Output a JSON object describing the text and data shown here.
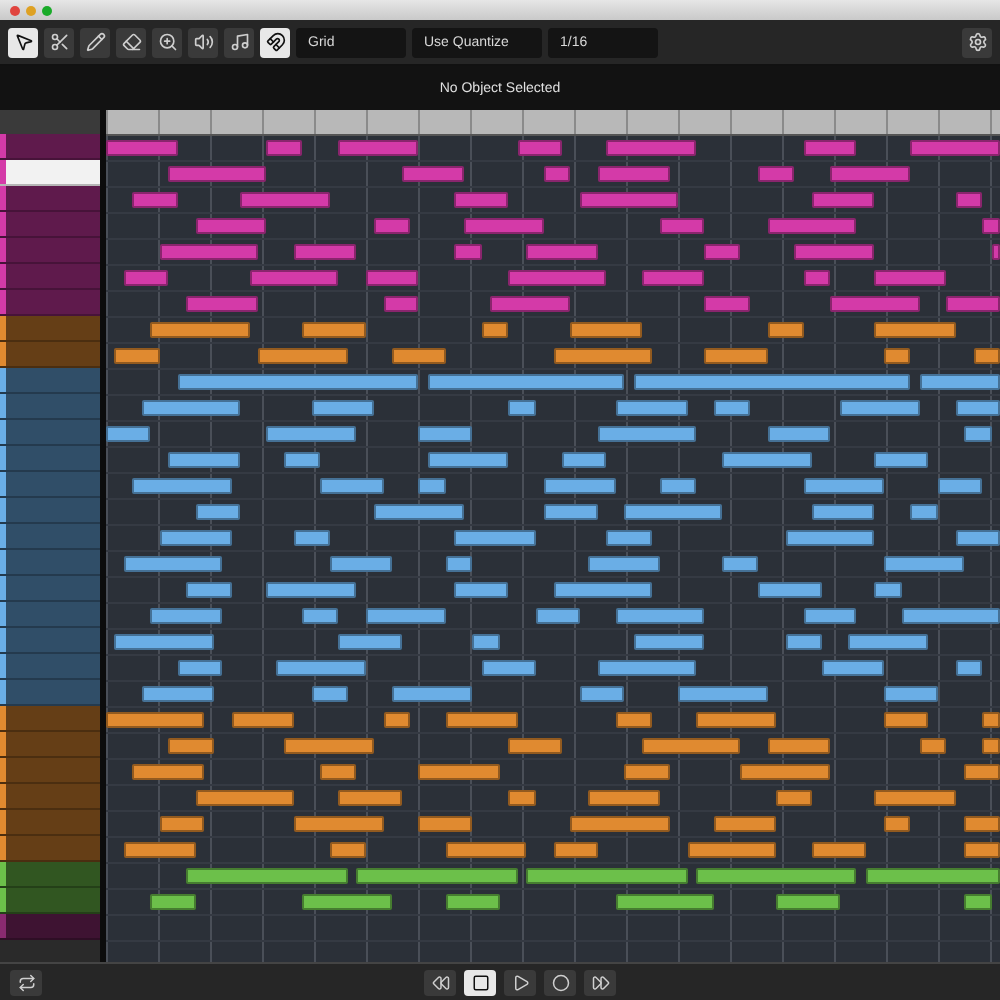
{
  "toolbar": {
    "snap_mode": "Grid",
    "quantize_mode": "Use Quantize",
    "quantize_value": "1/16"
  },
  "info_line": "No Object Selected",
  "tracks": [
    {
      "color": "#d43aa8",
      "selected": false
    },
    {
      "color": "#d43aa8",
      "selected": true
    },
    {
      "color": "#d43aa8",
      "selected": false
    },
    {
      "color": "#d43aa8",
      "selected": false
    },
    {
      "color": "#d43aa8",
      "selected": false
    },
    {
      "color": "#d43aa8",
      "selected": false
    },
    {
      "color": "#d43aa8",
      "selected": false
    },
    {
      "color": "#e08a30",
      "selected": false
    },
    {
      "color": "#e08a30",
      "selected": false
    },
    {
      "color": "#6aaee6",
      "selected": false
    },
    {
      "color": "#6aaee6",
      "selected": false
    },
    {
      "color": "#6aaee6",
      "selected": false
    },
    {
      "color": "#6aaee6",
      "selected": false
    },
    {
      "color": "#6aaee6",
      "selected": false
    },
    {
      "color": "#6aaee6",
      "selected": false
    },
    {
      "color": "#6aaee6",
      "selected": false
    },
    {
      "color": "#6aaee6",
      "selected": false
    },
    {
      "color": "#6aaee6",
      "selected": false
    },
    {
      "color": "#6aaee6",
      "selected": false
    },
    {
      "color": "#6aaee6",
      "selected": false
    },
    {
      "color": "#6aaee6",
      "selected": false
    },
    {
      "color": "#6aaee6",
      "selected": false
    },
    {
      "color": "#e08a30",
      "selected": false
    },
    {
      "color": "#e08a30",
      "selected": false
    },
    {
      "color": "#e08a30",
      "selected": false
    },
    {
      "color": "#e08a30",
      "selected": false
    },
    {
      "color": "#e08a30",
      "selected": false
    },
    {
      "color": "#e08a30",
      "selected": false
    },
    {
      "color": "#6cc04a",
      "selected": false
    },
    {
      "color": "#6cc04a",
      "selected": false
    },
    {
      "color": "#8a2a70",
      "selected": false
    }
  ]
}
